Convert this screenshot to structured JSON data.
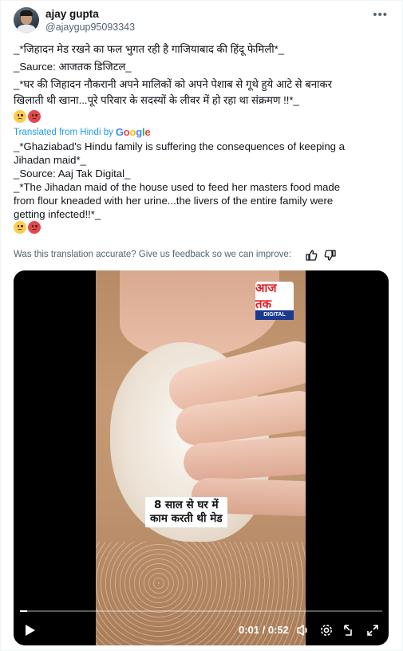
{
  "author": {
    "name": "ajay gupta",
    "handle": "@ajaygup95093343"
  },
  "original": {
    "line1": "_*जिहादन मेड रखने का फल भुगत रही है गाजियाबाद की हिंदू फेमिली*_",
    "line2": "_Saurce: आजतक डिजिटल_",
    "line3": "_*घर की जिहादन नौकरानी अपने मालिकों को अपने पेशाब से गूथे हुये आटे से बनाकर",
    "line4": "खिलाती थी खाना...पूरे परिवार के सदस्यों के लीवर में हो रहा था संक्रमण !!*_"
  },
  "translation_banner": {
    "label": "Translated from Hindi by",
    "brand": "Google"
  },
  "translated": {
    "line1": "_*Ghaziabad's Hindu family is suffering the consequences of keeping a",
    "line2": "Jihadan maid*_",
    "line3": "_Source: Aaj Tak Digital_",
    "line4": "_*The Jihadan maid of the house used to feed her masters food made",
    "line5": "from flour kneaded with her urine...the livers of the entire family were",
    "line6": "getting infected!!*_"
  },
  "feedback": {
    "text": "Was this translation accurate? Give us feedback so we can improve:",
    "thumbs_up_icon": "thumbs-up-icon",
    "thumbs_down_icon": "thumbs-down-icon"
  },
  "video": {
    "logo_top": "आज तक",
    "logo_bottom": "DIGITAL",
    "caption_line1": "8 साल से घर में",
    "caption_line2": "काम करती थी मेड",
    "current_time": "0:01",
    "duration": "0:52",
    "time_separator": " / ",
    "progress": 0.02
  },
  "colors": {
    "accent": "#1d9bf0",
    "text": "#0f1419",
    "muted": "#536471",
    "logo_red": "#e11b22",
    "logo_blue": "#1b3a8f"
  }
}
